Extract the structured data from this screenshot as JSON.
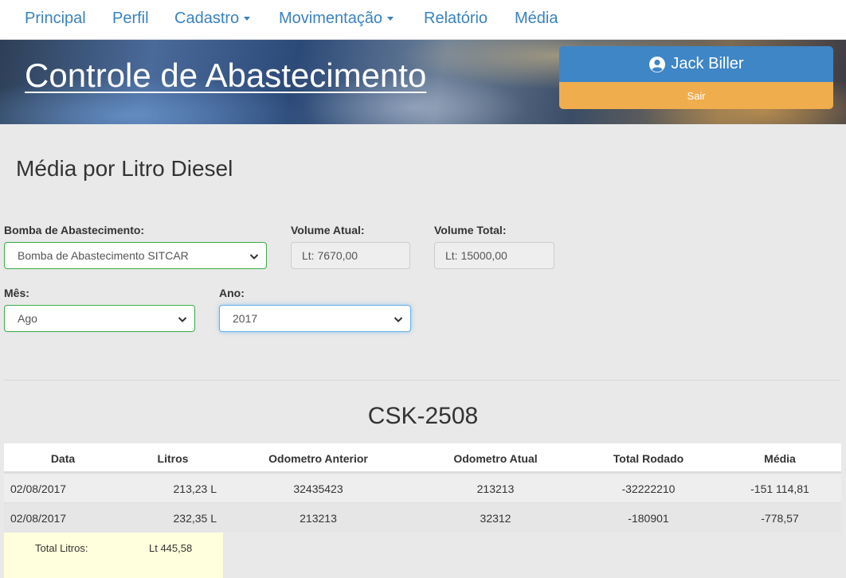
{
  "nav": {
    "items": [
      {
        "label": "Principal"
      },
      {
        "label": "Perfil"
      },
      {
        "label": "Cadastro"
      },
      {
        "label": "Movimentação"
      },
      {
        "label": "Relatório"
      },
      {
        "label": "Média"
      }
    ]
  },
  "header": {
    "title": "Controle de Abastecimento",
    "user_name": "Jack Biller",
    "logout_label": "Sair"
  },
  "page": {
    "title": "Média por Litro Diesel"
  },
  "form": {
    "bomba_label": "Bomba de Abastecimento:",
    "bomba_value": "Bomba de Abastecimento SITCAR",
    "volume_atual_label": "Volume Atual:",
    "volume_atual_value": "Lt: 7670,00",
    "volume_total_label": "Volume Total:",
    "volume_total_value": "Lt: 15000,00",
    "mes_label": "Mês:",
    "mes_value": "Ago",
    "ano_label": "Ano:",
    "ano_value": "2017"
  },
  "vehicle": {
    "plate": "CSK-2508"
  },
  "table": {
    "headers": [
      "Data",
      "Litros",
      "Odometro Anterior",
      "Odometro Atual",
      "Total Rodado",
      "Média"
    ],
    "rows": [
      [
        "02/08/2017",
        "213,23 L",
        "32435423",
        "213213",
        "-32222210",
        "-151 114,81"
      ],
      [
        "02/08/2017",
        "232,35 L",
        "213213",
        "32312",
        "-180901",
        "-778,57"
      ]
    ]
  },
  "totals": {
    "label": "Total Litros:",
    "value": "Lt 445,58"
  }
}
